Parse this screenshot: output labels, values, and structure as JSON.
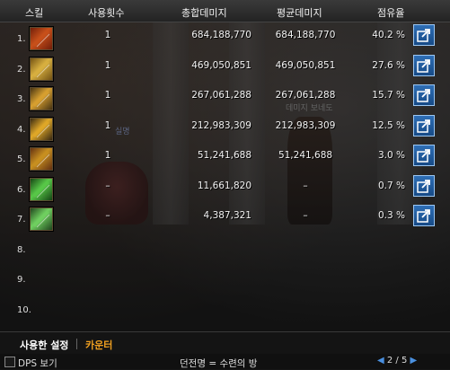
{
  "header": {
    "col_skill": "스킬",
    "col_uses": "사용횟수",
    "col_total": "총합데미지",
    "col_avg": "평균데미지",
    "col_share": "점유율"
  },
  "rows": [
    {
      "num": "1.",
      "uses": "1",
      "total": "684,188,770",
      "avg": "684,188,770",
      "share": "40.2 %",
      "icon": "skill-fire-claw-icon",
      "colors": [
        "#c8501a",
        "#6a1a08"
      ]
    },
    {
      "num": "2.",
      "uses": "1",
      "total": "469,050,851",
      "avg": "469,050,851",
      "share": "27.6 %",
      "icon": "skill-cross-slash-icon",
      "colors": [
        "#d8b040",
        "#6a4a10"
      ]
    },
    {
      "num": "3.",
      "uses": "1",
      "total": "267,061,288",
      "avg": "267,061,288",
      "share": "15.7 %",
      "icon": "skill-wave-slash-icon",
      "colors": [
        "#d8a030",
        "#3a2a10"
      ]
    },
    {
      "num": "4.",
      "uses": "1",
      "total": "212,983,309",
      "avg": "212,983,309",
      "share": "12.5 %",
      "icon": "skill-swift-slash-icon",
      "colors": [
        "#e0a828",
        "#2a1e10"
      ]
    },
    {
      "num": "5.",
      "uses": "1",
      "total": "51,241,688",
      "avg": "51,241,688",
      "share": "3.0 %",
      "icon": "skill-blade-strike-icon",
      "colors": [
        "#c89020",
        "#5a2810"
      ]
    },
    {
      "num": "6.",
      "uses": "–",
      "total": "11,661,820",
      "avg": "–",
      "share": "0.7 %",
      "icon": "skill-green-blade-icon",
      "colors": [
        "#58c848",
        "#103a10"
      ]
    },
    {
      "num": "7.",
      "uses": "–",
      "total": "4,387,321",
      "avg": "–",
      "share": "0.3 %",
      "icon": "skill-green-sword-icon",
      "colors": [
        "#70d060",
        "#1a3a18"
      ]
    },
    {
      "num": "8."
    },
    {
      "num": "9."
    },
    {
      "num": "10."
    }
  ],
  "scene_text": {
    "left_name": "실명",
    "right_name": "데미지 보네도"
  },
  "tabs": {
    "active": "사용한 설정",
    "inactive": "카운터"
  },
  "footer": {
    "dps_label": "DPS 보기",
    "dungeon": "던전명 = 수련의 방",
    "page": "2 / 5"
  },
  "colors": {
    "active_tab": "#ffffff",
    "inactive_tab": "#f0a020",
    "share_button": "#2f6fb6"
  }
}
